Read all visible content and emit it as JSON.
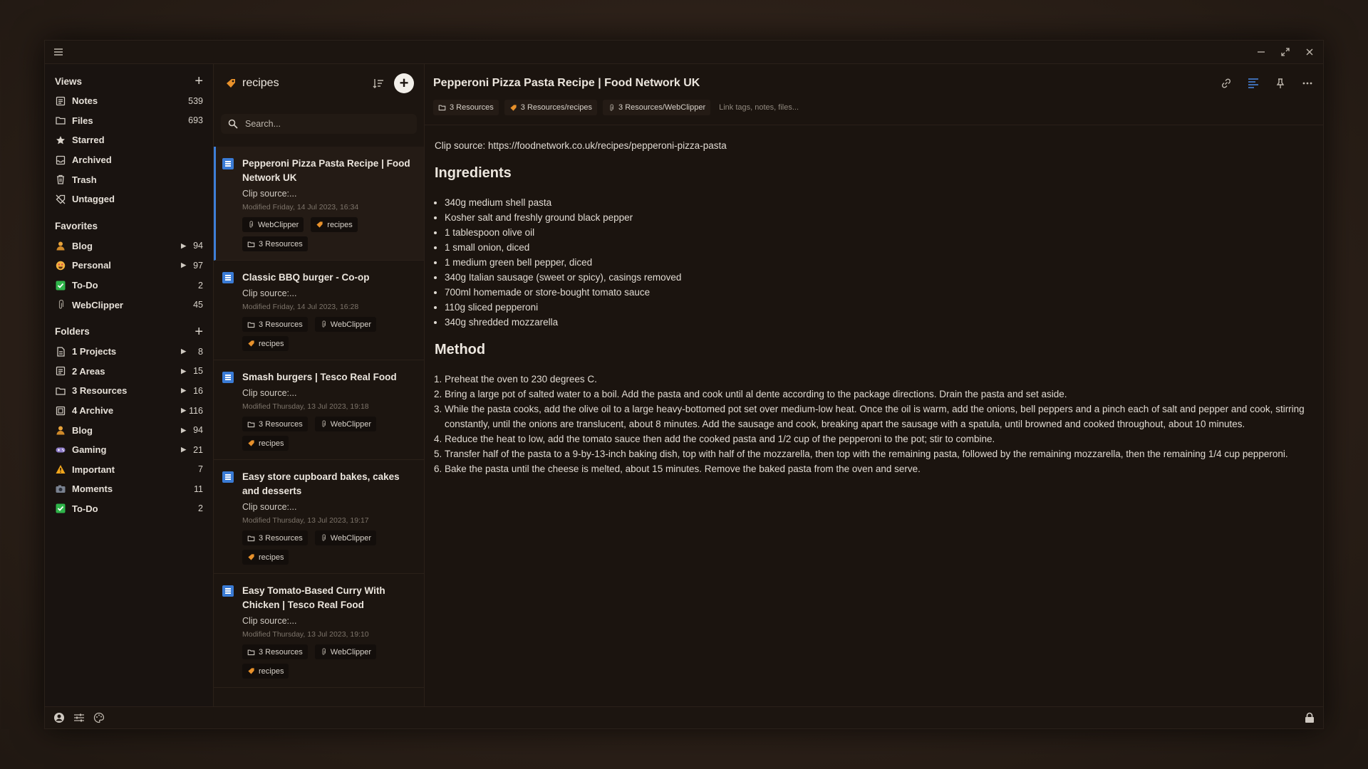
{
  "sidebar": {
    "views_title": "Views",
    "views": [
      {
        "label": "Notes",
        "count": "539",
        "icon": "notes-icon"
      },
      {
        "label": "Files",
        "count": "693",
        "icon": "folder-icon"
      },
      {
        "label": "Starred",
        "count": "",
        "icon": "star-icon"
      },
      {
        "label": "Archived",
        "count": "",
        "icon": "archive-icon"
      },
      {
        "label": "Trash",
        "count": "",
        "icon": "trash-icon"
      },
      {
        "label": "Untagged",
        "count": "",
        "icon": "untagged-icon"
      }
    ],
    "favorites_title": "Favorites",
    "favorites": [
      {
        "label": "Blog",
        "count": "94",
        "icon": "person-emoji-icon",
        "expandable": true
      },
      {
        "label": "Personal",
        "count": "97",
        "icon": "smiley-emoji-icon",
        "expandable": true
      },
      {
        "label": "To-Do",
        "count": "2",
        "icon": "checkbox-emoji-icon",
        "expandable": false
      },
      {
        "label": "WebClipper",
        "count": "45",
        "icon": "paperclip-icon",
        "expandable": false
      }
    ],
    "folders_title": "Folders",
    "folders": [
      {
        "label": "1 Projects",
        "count": "8",
        "icon": "doc-icon",
        "expandable": true
      },
      {
        "label": "2 Areas",
        "count": "15",
        "icon": "notes-icon",
        "expandable": true
      },
      {
        "label": "3 Resources",
        "count": "16",
        "icon": "folder-icon",
        "expandable": true
      },
      {
        "label": "4 Archive",
        "count": "116",
        "icon": "archive-box-icon",
        "expandable": true
      },
      {
        "label": "Blog",
        "count": "94",
        "icon": "person-emoji-icon",
        "expandable": true
      },
      {
        "label": "Gaming",
        "count": "21",
        "icon": "gamepad-emoji-icon",
        "expandable": true
      },
      {
        "label": "Important",
        "count": "7",
        "icon": "warning-emoji-icon",
        "expandable": false
      },
      {
        "label": "Moments",
        "count": "11",
        "icon": "camera-emoji-icon",
        "expandable": false
      },
      {
        "label": "To-Do",
        "count": "2",
        "icon": "checkbox-emoji-icon",
        "expandable": false
      }
    ]
  },
  "notelist": {
    "title": "recipes",
    "search_placeholder": "Search...",
    "notes": [
      {
        "title": "Pepperoni Pizza Pasta Recipe | Food Network UK",
        "snippet": "Clip source:...",
        "modified": "Modified Friday, 14 Jul 2023, 16:34",
        "tags": [
          "WebClipper",
          "recipes",
          "3 Resources"
        ],
        "active": true
      },
      {
        "title": "Classic BBQ burger - Co-op",
        "snippet": "Clip source:...",
        "modified": "Modified Friday, 14 Jul 2023, 16:28",
        "tags": [
          "3 Resources",
          "WebClipper",
          "recipes"
        ],
        "active": false
      },
      {
        "title": "Smash burgers | Tesco Real Food",
        "snippet": "Clip source:...",
        "modified": "Modified Thursday, 13 Jul 2023, 19:18",
        "tags": [
          "3 Resources",
          "WebClipper",
          "recipes"
        ],
        "active": false
      },
      {
        "title": "Easy store cupboard bakes, cakes and desserts",
        "snippet": "Clip source:...",
        "modified": "Modified Thursday, 13 Jul 2023, 19:17",
        "tags": [
          "3 Resources",
          "WebClipper",
          "recipes"
        ],
        "active": false
      },
      {
        "title": "Easy Tomato-Based Curry With Chicken | Tesco Real Food",
        "snippet": "Clip source:...",
        "modified": "Modified Thursday, 13 Jul 2023, 19:10",
        "tags": [
          "3 Resources",
          "WebClipper",
          "recipes"
        ],
        "active": false
      }
    ]
  },
  "content": {
    "title": "Pepperoni Pizza Pasta Recipe | Food Network UK",
    "tags": [
      "3 Resources",
      "3 Resources/recipes",
      "3 Resources/WebClipper"
    ],
    "link_hint": "Link tags, notes, files...",
    "clip_source": "Clip source: https://foodnetwork.co.uk/recipes/pepperoni-pizza-pasta",
    "ingredients_heading": "Ingredients",
    "ingredients": [
      "340g medium shell pasta",
      "Kosher salt and freshly ground black pepper",
      "1 tablespoon olive oil",
      "1 small onion, diced",
      "1 medium green bell pepper, diced",
      "340g Italian sausage (sweet or spicy), casings removed",
      "700ml homemade or store-bought tomato sauce",
      "110g sliced pepperoni",
      "340g shredded mozzarella"
    ],
    "method_heading": "Method",
    "method": [
      "Preheat the oven to 230 degrees C.",
      "Bring a large pot of salted water to a boil. Add the pasta and cook until al dente according to the package directions. Drain the pasta and set aside.",
      "While the pasta cooks, add the olive oil to a large heavy-bottomed pot set over medium-low heat. Once the oil is warm, add the onions, bell peppers and a pinch each of salt and pepper and cook, stirring constantly, until the onions are translucent, about 8 minutes. Add the sausage and cook, breaking apart the sausage with a spatula, until browned and cooked throughout, about 10 minutes.",
      "Reduce the heat to low, add the tomato sauce then add the cooked pasta and 1/2 cup of the pepperoni to the pot; stir to combine.",
      "Transfer half of the pasta to a 9-by-13-inch baking dish, top with half of the mozzarella, then top with the remaining pasta, followed by the remaining mozzarella, then the remaining 1/4 cup pepperoni.",
      "Bake the pasta until the cheese is melted, about 15 minutes. Remove the baked pasta from the oven and serve."
    ]
  },
  "colors": {
    "accent": "#3e7fd8",
    "tag_recipes": "#e8912b",
    "todo_green": "#2fb54a"
  }
}
